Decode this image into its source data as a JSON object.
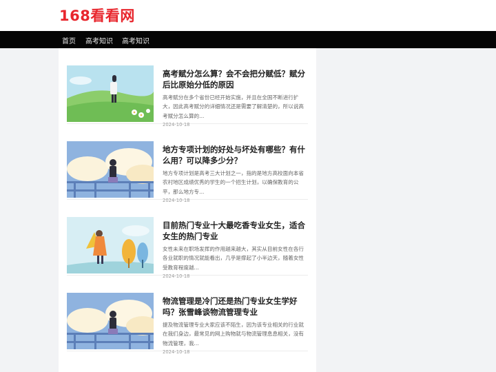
{
  "site": {
    "logo": "168看看网"
  },
  "nav": [
    "首页",
    "高考知识",
    "高考知识"
  ],
  "articles": [
    {
      "title": "高考赋分怎么算？会不会把分赋低？赋分后比原始分低的原因",
      "desc": "高考赋分在多个省份已经开始实施，并且在全国不断进行扩大，因此高考赋分的详细情况还是需要了解清楚的，所以说高考赋分怎么算的...",
      "date": "2024-10-18",
      "thumb_icon": "girl-on-green-hill-illustration"
    },
    {
      "title": "地方专项计划的好处与坏处有哪些？有什么用？可以降多少分？",
      "desc": "地方专项计划是高考三大计划之一，指的是地方高校面向本省农村地区成绩优秀的学生的一个招生计划，以确保教育的公平，那么地方专...",
      "date": "2024-10-18",
      "thumb_icon": "girl-at-railing-clouds-illustration"
    },
    {
      "title": "目前热门专业十大最吃香专业女生，适合女生的热门专业",
      "desc": "女性未来在职场发挥的作用越来越大，其实从目前女性在各行各业就职的情况就能看出，几乎是撑起了小半边天，随着女性受教育程度越...",
      "date": "2024-10-18",
      "thumb_icon": "girl-with-cape-trees-illustration"
    },
    {
      "title": "物流管理是冷门还是热门专业女生学好吗？张雪峰谈物流管理专业",
      "desc": "提及物流管理专业大家应该不陌生，因为该专业相关的行业就在我们身边，最常见的网上购物就与物流管理息息相关，没有物流管理，我...",
      "date": "2024-10-18",
      "thumb_icon": "girl-at-railing-clouds-illustration"
    }
  ]
}
